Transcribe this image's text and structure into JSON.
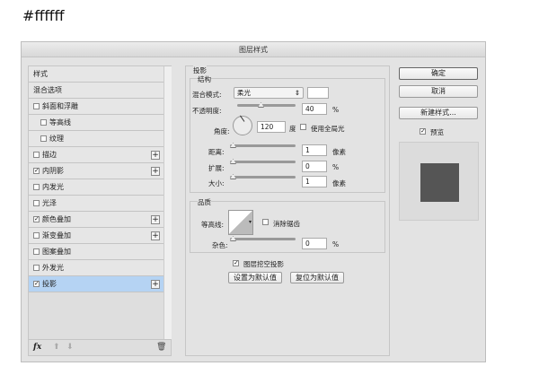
{
  "caption": "#ffffff",
  "dialog": {
    "title": "图层样式"
  },
  "sidebar": {
    "items": [
      {
        "label": "样式",
        "checkbox": null,
        "plus": false,
        "indent": false
      },
      {
        "label": "混合选项",
        "checkbox": null,
        "plus": false,
        "indent": false
      },
      {
        "label": "斜面和浮雕",
        "checkbox": false,
        "plus": false,
        "indent": false
      },
      {
        "label": "等高线",
        "checkbox": false,
        "plus": false,
        "indent": true
      },
      {
        "label": "纹理",
        "checkbox": false,
        "plus": false,
        "indent": true
      },
      {
        "label": "描边",
        "checkbox": false,
        "plus": true,
        "indent": false
      },
      {
        "label": "内阴影",
        "checkbox": true,
        "plus": true,
        "indent": false
      },
      {
        "label": "内发光",
        "checkbox": false,
        "plus": false,
        "indent": false
      },
      {
        "label": "光泽",
        "checkbox": false,
        "plus": false,
        "indent": false
      },
      {
        "label": "颜色叠加",
        "checkbox": true,
        "plus": true,
        "indent": false
      },
      {
        "label": "渐变叠加",
        "checkbox": false,
        "plus": true,
        "indent": false
      },
      {
        "label": "图案叠加",
        "checkbox": false,
        "plus": false,
        "indent": false
      },
      {
        "label": "外发光",
        "checkbox": false,
        "plus": false,
        "indent": false
      },
      {
        "label": "投影",
        "checkbox": true,
        "plus": true,
        "indent": false,
        "selected": true
      }
    ],
    "footer": {
      "fx": "fx"
    }
  },
  "panel": {
    "section": "投影",
    "structure": "结构",
    "blend_label": "混合模式:",
    "blend_value": "柔光",
    "opacity_label": "不透明度:",
    "opacity_value": "40",
    "opacity_unit": "%",
    "opacity_pct": 40,
    "angle_label": "角度:",
    "angle_value": "120",
    "angle_unit": "度",
    "global_light": "使用全局光",
    "global_light_checked": false,
    "distance_label": "距离:",
    "distance_value": "1",
    "distance_unit": "像素",
    "spread_label": "扩展:",
    "spread_value": "0",
    "spread_unit": "%",
    "size_label": "大小:",
    "size_value": "1",
    "size_unit": "像素",
    "quality": "品质",
    "contour_label": "等高线:",
    "antialias": "消除锯齿",
    "antialias_checked": false,
    "noise_label": "杂色:",
    "noise_value": "0",
    "noise_unit": "%",
    "knockout": "图层挖空投影",
    "knockout_checked": true,
    "make_default": "设置为默认值",
    "reset_default": "复位为默认值"
  },
  "right": {
    "ok": "确定",
    "cancel": "取消",
    "new_style": "新建样式...",
    "preview": "预览",
    "preview_checked": true,
    "swatch_color": "#555555"
  }
}
